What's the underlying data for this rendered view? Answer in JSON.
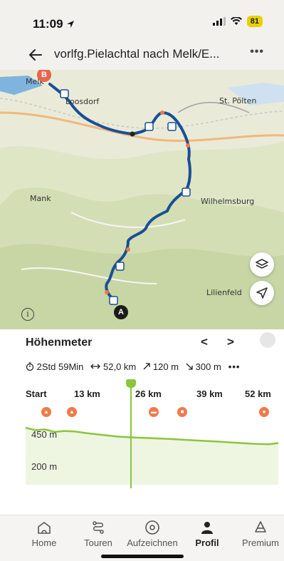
{
  "status_bar": {
    "time": "11:09",
    "battery": "81"
  },
  "header": {
    "title": "vorlfg.Pielachtal nach Melk/E...",
    "more": "•••"
  },
  "map": {
    "labels": {
      "melk": "Melk",
      "loosdorf": "Loosdorf",
      "st_poelten": "St. Pölten",
      "mank": "Mank",
      "wilhelmsburg": "Wilhelmsburg",
      "lilienfeld": "Lilienfeld"
    },
    "marker_start": "A",
    "marker_end": "B",
    "info": "i"
  },
  "elevation": {
    "title": "Höhenmeter",
    "prev": "<",
    "next": ">",
    "stats": {
      "duration": "2Std 59Min",
      "distance": "52,0 km",
      "ascent": "120 m",
      "descent": "300 m",
      "more": "•••"
    },
    "km_labels": [
      "Start",
      "13 km",
      "26 km",
      "39 km",
      "52 km"
    ],
    "y_labels": [
      "450 m",
      "200 m"
    ],
    "chart_data": {
      "type": "area",
      "xlabel": "",
      "ylabel": "",
      "categories": [
        "Start",
        "13 km",
        "26 km",
        "39 km",
        "52 km"
      ],
      "x": [
        0,
        2,
        4,
        6,
        8,
        10,
        13,
        16,
        19,
        22,
        26,
        30,
        34,
        39,
        43,
        47,
        50,
        52
      ],
      "series": [
        {
          "values": [
            455,
            440,
            445,
            430,
            435,
            432,
            420,
            410,
            400,
            395,
            390,
            385,
            378,
            370,
            362,
            355,
            352,
            360
          ]
        }
      ],
      "ylim": [
        100,
        500
      ]
    }
  },
  "bottom_nav": {
    "items": [
      {
        "label": "Home",
        "icon": "home-icon"
      },
      {
        "label": "Touren",
        "icon": "route-icon"
      },
      {
        "label": "Aufzeichnen",
        "icon": "record-icon"
      },
      {
        "label": "Profil",
        "icon": "profile-icon"
      },
      {
        "label": "Premium",
        "icon": "premium-icon"
      }
    ]
  },
  "colors": {
    "route": "#1a4f95",
    "elevation": "#8ac53e",
    "poi": "#f07a4a"
  }
}
